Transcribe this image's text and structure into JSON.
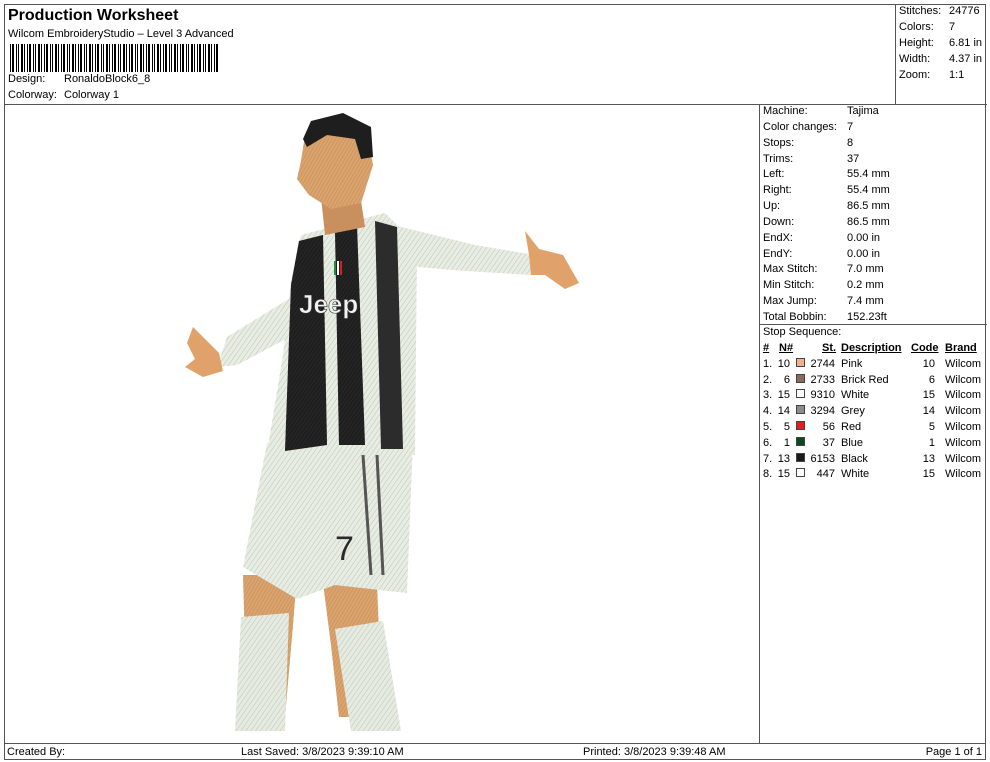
{
  "header": {
    "title": "Production Worksheet",
    "subtitle": "Wilcom EmbroideryStudio – Level 3 Advanced",
    "design_label": "Design:",
    "design_value": "RonaldoBlock6_8",
    "colorway_label": "Colorway:",
    "colorway_value": "Colorway 1"
  },
  "summary": [
    {
      "label": "Stitches:",
      "value": "24776"
    },
    {
      "label": "Colors:",
      "value": "7"
    },
    {
      "label": "Height:",
      "value": "6.81 in"
    },
    {
      "label": "Width:",
      "value": "4.37 in"
    },
    {
      "label": "Zoom:",
      "value": "1:1"
    }
  ],
  "details": [
    {
      "label": "Machine:",
      "value": "Tajima"
    },
    {
      "label": "Color changes:",
      "value": "7"
    },
    {
      "label": "Stops:",
      "value": "8"
    },
    {
      "label": "Trims:",
      "value": "37"
    },
    {
      "label": "Left:",
      "value": "55.4 mm"
    },
    {
      "label": "Right:",
      "value": "55.4 mm"
    },
    {
      "label": "Up:",
      "value": "86.5 mm"
    },
    {
      "label": "Down:",
      "value": "86.5 mm"
    },
    {
      "label": "EndX:",
      "value": "0.00 in"
    },
    {
      "label": "EndY:",
      "value": "0.00 in"
    },
    {
      "label": "Max Stitch:",
      "value": "7.0 mm"
    },
    {
      "label": "Min Stitch:",
      "value": "0.2 mm"
    },
    {
      "label": "Max Jump:",
      "value": "7.4 mm"
    },
    {
      "label": "Total Bobbin:",
      "value": "152.23ft"
    }
  ],
  "stop_sequence": {
    "title": "Stop Sequence:",
    "headers": {
      "num": "#",
      "n": "N#",
      "st": "St.",
      "description": "Description",
      "code": "Code",
      "brand": "Brand"
    },
    "rows": [
      {
        "num": "1.",
        "n": "10",
        "color": "#f0b090",
        "st": "2744",
        "description": "Pink",
        "code": "10",
        "brand": "Wilcom"
      },
      {
        "num": "2.",
        "n": "6",
        "color": "#8a6a5a",
        "st": "2733",
        "description": "Brick Red",
        "code": "6",
        "brand": "Wilcom"
      },
      {
        "num": "3.",
        "n": "15",
        "color": "#ffffff",
        "st": "9310",
        "description": "White",
        "code": "15",
        "brand": "Wilcom"
      },
      {
        "num": "4.",
        "n": "14",
        "color": "#8c8c8c",
        "st": "3294",
        "description": "Grey",
        "code": "14",
        "brand": "Wilcom"
      },
      {
        "num": "5.",
        "n": "5",
        "color": "#e02020",
        "st": "56",
        "description": "Red",
        "code": "5",
        "brand": "Wilcom"
      },
      {
        "num": "6.",
        "n": "1",
        "color": "#0b4a1c",
        "st": "37",
        "description": "Blue",
        "code": "1",
        "brand": "Wilcom"
      },
      {
        "num": "7.",
        "n": "13",
        "color": "#1a1a1a",
        "st": "6153",
        "description": "Black",
        "code": "13",
        "brand": "Wilcom"
      },
      {
        "num": "8.",
        "n": "15",
        "color": "#ffffff",
        "st": "447",
        "description": "White",
        "code": "15",
        "brand": "Wilcom"
      }
    ]
  },
  "jersey": {
    "sponsor": "Jeep",
    "number": "7"
  },
  "footer": {
    "created_by": "Created By:",
    "last_saved": "Last Saved: 3/8/2023 9:39:10 AM",
    "printed": "Printed: 3/8/2023 9:39:48 AM",
    "page": "Page 1 of 1"
  }
}
